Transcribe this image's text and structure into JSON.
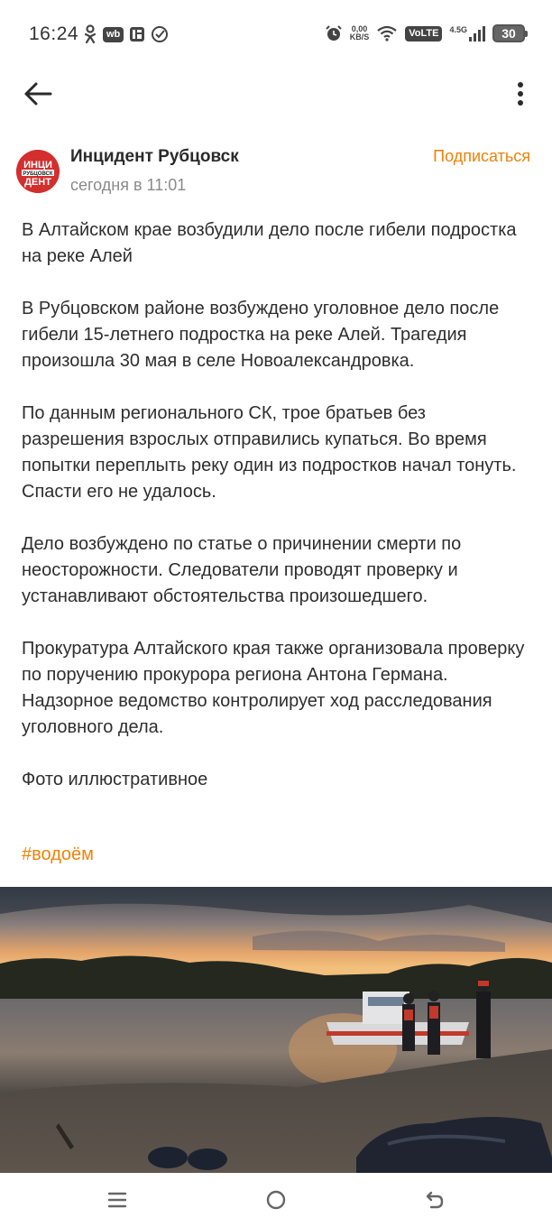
{
  "status_bar": {
    "time": "16:24",
    "net_speed_value": "0,00",
    "net_speed_unit": "KB/S",
    "volte": "VoLTE",
    "network": "4.5G",
    "battery": "30",
    "wb_badge": "wb"
  },
  "app_bar": {
    "back_icon": "arrow-left-icon",
    "menu_icon": "more-vert-icon"
  },
  "post": {
    "author": "Инцидент Рубцовск",
    "avatar_text_top": "ИНЦИ",
    "avatar_text_mid": "РУБЦОВСК",
    "avatar_text_bottom": "ДЕНТ",
    "time": "сегодня в 11:01",
    "subscribe_label": "Подписаться",
    "paragraphs": [
      "В Алтайском крае возбудили дело после гибели подростка на реке Алей",
      "В Рубцовском районе возбуждено уголовное дело после гибели 15-летнего подростка на реке Алей. Трагедия произошла 30 мая в селе Новоалександровка.",
      "По данным регионального СК, трое братьев без разрешения взрослых отправились купаться. Во время попытки переплыть реку один из подростков начал тонуть. Спасти его не удалось.",
      "Дело возбуждено по статье о причинении смерти по неосторожности. Следователи проводят проверку и устанавливают обстоятельства произошедшего.",
      "Прокуратура Алтайского края также организовала проверку по поручению прокурора региона Антона Германа. Надзорное ведомство контролирует ход расследования уголовного дела.",
      "Фото иллюстративное"
    ],
    "hashtag": "#водоём"
  },
  "colors": {
    "accent": "#ee8208",
    "avatar_red": "#d32f2f",
    "text": "#2e2e2e",
    "muted": "#8a8a8a"
  }
}
